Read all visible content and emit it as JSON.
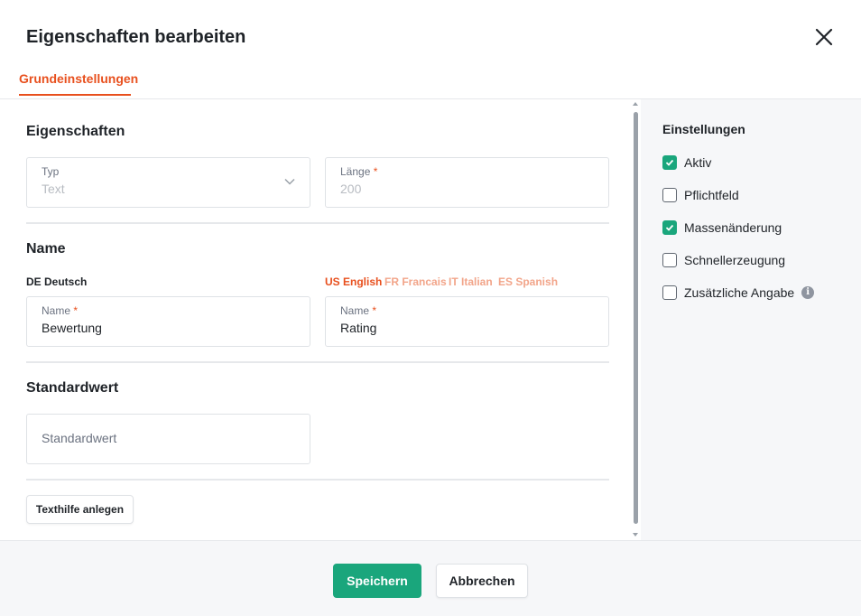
{
  "dialog": {
    "title": "Eigenschaften bearbeiten",
    "tab_label": "Grundeinstellungen"
  },
  "properties": {
    "section_title": "Eigenschaften",
    "type_label": "Typ",
    "type_value": "Text",
    "length_label": "Länge",
    "length_required": "*",
    "length_value": "200"
  },
  "name": {
    "section_title": "Name",
    "de_label": "DE Deutsch",
    "languages": [
      {
        "label": "US English",
        "active": true
      },
      {
        "label": "FR Francais",
        "active": false
      },
      {
        "label": "IT Italian",
        "active": false
      },
      {
        "label": "ES Spanish",
        "active": false
      }
    ],
    "field_label": "Name",
    "required": "*",
    "de_value": "Bewertung",
    "other_value": "Rating"
  },
  "default_value": {
    "section_title": "Standardwert",
    "placeholder": "Standardwert"
  },
  "texthilfe_button": "Texthilfe anlegen",
  "sidebar": {
    "title": "Einstellungen",
    "options": [
      {
        "label": "Aktiv",
        "checked": true
      },
      {
        "label": "Pflichtfeld",
        "checked": false
      },
      {
        "label": "Massenänderung",
        "checked": true
      },
      {
        "label": "Schnellerzeugung",
        "checked": false
      },
      {
        "label": "Zusätzliche Angabe",
        "checked": false,
        "info_icon": "info-icon"
      }
    ]
  },
  "footer": {
    "save_label": "Speichern",
    "cancel_label": "Abbrechen"
  },
  "colors": {
    "accent": "#e8501e",
    "primary_button": "#1aa67c",
    "checkbox_checked": "#1aa67c"
  }
}
